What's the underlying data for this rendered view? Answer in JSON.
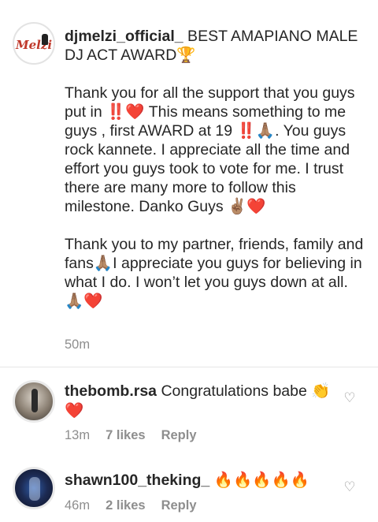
{
  "caption": {
    "avatar_logo_text": "Melzi",
    "username": "djmelzi_official_",
    "title": " BEST AMAPIANO MALE DJ ACT AWARD🏆",
    "paragraph1": "Thank you for all the support that you guys put in ‼️❤️ This means something to me guys , first AWARD at 19 ‼️🙏🏽. You guys rock kannete. I appreciate all the time and effort you guys took to vote for me. I trust there are many more to follow this milestone. Danko Guys ✌🏽❤️",
    "paragraph2": "Thank you to my partner, friends, family and fans🙏🏽I appreciate you guys for believing in what I do. I won’t let you guys down at all.🙏🏽❤️",
    "time": "50m"
  },
  "comments": [
    {
      "username": "thebomb.rsa",
      "text": " Congratulations babe 👏❤️",
      "time": "13m",
      "likes": "7 likes",
      "reply": "Reply",
      "like_icon": "heart-outline-icon"
    },
    {
      "username": "shawn100_theking_",
      "text": " 🔥🔥🔥🔥🔥",
      "time": "46m",
      "likes": "2 likes",
      "reply": "Reply",
      "like_icon": "heart-outline-icon"
    }
  ],
  "colors": {
    "text": "#262626",
    "meta": "#8e8e8e",
    "divider": "#e6e6e6"
  }
}
